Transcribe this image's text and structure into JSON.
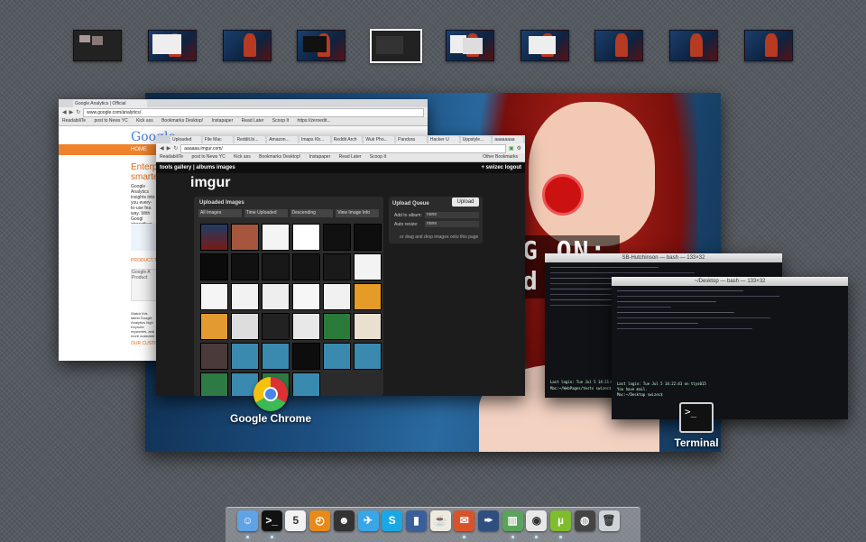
{
  "spaces": [
    {
      "kind": "dark-windows"
    },
    {
      "kind": "desktop-window"
    },
    {
      "kind": "desktop"
    },
    {
      "kind": "desktop-dark-window"
    },
    {
      "kind": "dark-active"
    },
    {
      "kind": "desktop-windows"
    },
    {
      "kind": "desktop-window"
    },
    {
      "kind": "desktop"
    },
    {
      "kind": "desktop"
    },
    {
      "kind": "desktop"
    }
  ],
  "analytics_window": {
    "tab": "Google Analytics | Official",
    "url": "www.google.com/analytics/",
    "bookmarks": [
      "ReadabiliTe",
      "post to News YC",
      "Kick ass",
      "Bookmarks Desktop!",
      "Instapaper",
      "Read Later",
      "Scoop It",
      "https://zeroedit..."
    ],
    "nav": "HOME",
    "logo": "Google",
    "headline": "Enterpr smarter",
    "body1": "Google Analytics insights into you every-to-use fea way. With Googl strengthen your",
    "product_tour": "PRODUCT TO",
    "product_label": "Google A Product",
    "watch": "Watch this latest Google Analytics high Keynote mysteries, and more customer",
    "customers": "OUR CUSTOMER"
  },
  "imgur_window": {
    "tabs": [
      "Uploaded",
      "File Mac",
      "Reddit.bi...",
      "Amazon...",
      "Imaps Kb...",
      "Reddit Arch",
      "Wuk Pho...",
      "Pandora",
      "Hacker U",
      "Uppstyle...",
      "aaaaaaaa"
    ],
    "url": "aaaaaa.imgur.com/",
    "bookmarks": [
      "ReadabiliTe",
      "post to News YC",
      "Kick ass",
      "Bookmarks Desktop!",
      "Instapaper",
      "Read Later",
      "Scoop It",
      "Other Bookmarks"
    ],
    "nav_left": "tools  gallery | albums  images",
    "nav_right": "+ swizec   logout",
    "logo": "imgur",
    "uploaded_title": "Uploaded Images",
    "filters": [
      "All Images",
      "Time Uploaded",
      "Descending",
      "View Image Info"
    ],
    "queue_title": "Upload Queue",
    "upload_btn": "Upload",
    "add_album_label": "Add to album:",
    "add_album_value": "none",
    "auto_resize_label": "Auto resize:",
    "auto_resize_value": "none",
    "drag_text": "or drag and drop images onto this page",
    "app_label": "Google Chrome"
  },
  "desktop_text": {
    "line1": "G ON:",
    "line2": "d"
  },
  "term_back": {
    "title": "SB-Hutchinson — bash — 133×32",
    "login": "Last login: Tue Jul  5 14:21:05 on ttys004",
    "prompt": "Mac:~/WebPages/tests swizec$ "
  },
  "term_front": {
    "title": "~/Desktop — bash — 133×32",
    "login": "Last login: Tue Jul  5 14:22:43 on ttys015",
    "mail": "You have mail.",
    "prompt": "Mac:~/Desktop swizec$ ",
    "app_label": "Terminal"
  },
  "dock": [
    {
      "name": "finder-icon",
      "color": "#5fa3e6",
      "glyph": "☺"
    },
    {
      "name": "terminal-icon",
      "color": "#111",
      "glyph": ">_"
    },
    {
      "name": "ical-icon",
      "color": "#f2f2f2",
      "glyph": "5"
    },
    {
      "name": "clock-icon",
      "color": "#e88a1a",
      "glyph": "◴"
    },
    {
      "name": "alien-icon",
      "color": "#333",
      "glyph": "☻"
    },
    {
      "name": "twitter-icon",
      "color": "#3aa6e8",
      "glyph": "✈"
    },
    {
      "name": "skype-icon",
      "color": "#19a7e6",
      "glyph": "S"
    },
    {
      "name": "remote-icon",
      "color": "#3a5f9a",
      "glyph": "▮"
    },
    {
      "name": "teacup-icon",
      "color": "#efeadf",
      "glyph": "☕"
    },
    {
      "name": "mailbox-icon",
      "color": "#d9532a",
      "glyph": "✉"
    },
    {
      "name": "pen-icon",
      "color": "#2f4f7f",
      "glyph": "✒"
    },
    {
      "name": "stats-icon",
      "color": "#5aa35a",
      "glyph": "▥"
    },
    {
      "name": "chrome-icon",
      "color": "#e8e8e8",
      "glyph": "◉"
    },
    {
      "name": "utorrent-icon",
      "color": "#7fbd2f",
      "glyph": "µ"
    },
    {
      "name": "camera-icon",
      "color": "#444",
      "glyph": "◍"
    },
    {
      "name": "trash-icon",
      "color": "#cfd4d9",
      "glyph": "🗑"
    }
  ]
}
